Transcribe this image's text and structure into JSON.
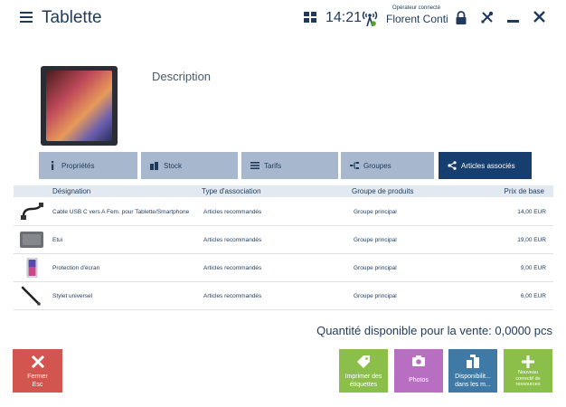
{
  "header": {
    "title": "Tablette",
    "time": "14:21",
    "operator_label": "Opérateur connecté",
    "operator_name": "Florent Conti"
  },
  "product": {
    "description": "Description"
  },
  "tabs": [
    {
      "label": "Propriétés",
      "icon": "info-icon",
      "active": false
    },
    {
      "label": "Stock",
      "icon": "warehouse-icon",
      "active": false
    },
    {
      "label": "Tarifs",
      "icon": "list-icon",
      "active": false
    },
    {
      "label": "Groupes",
      "icon": "tree-icon",
      "active": false
    },
    {
      "label": "Articles associés",
      "icon": "share-icon",
      "active": true
    }
  ],
  "table": {
    "headers": {
      "designation": "Désignation",
      "type": "Type d'association",
      "group": "Groupe de produits",
      "price": "Prix de base"
    },
    "rows": [
      {
        "name": "Cable USB C vers A Fem. pour Tablette/Smartphone",
        "type": "Articles recommandés",
        "group": "Groupe principal",
        "price": "14,00 EUR",
        "thumb": "cable-thumbnail"
      },
      {
        "name": "Etui",
        "type": "Articles recommandés",
        "group": "Groupe principal",
        "price": "19,00 EUR",
        "thumb": "case-thumbnail"
      },
      {
        "name": "Protection d'écran",
        "type": "Articles recommandés",
        "group": "Groupe principal",
        "price": "9,00 EUR",
        "thumb": "phone-thumbnail"
      },
      {
        "name": "Stylet universel",
        "type": "Articles recommandés",
        "group": "Groupe principal",
        "price": "6,00 EUR",
        "thumb": "stylus-thumbnail"
      }
    ]
  },
  "quantity": "Quantité disponible pour la vente: 0,0000 pcs",
  "buttons": {
    "close": {
      "line1": "Fermer",
      "line2": "Esc"
    },
    "print": {
      "line1": "Imprimer des",
      "line2": "étiquettes"
    },
    "photos": {
      "line1": "Photos"
    },
    "dispo": {
      "line1": "Disponibilit...",
      "line2": "dans les m..."
    },
    "new": {
      "line1": "Nouveau",
      "line2": "correctif de",
      "line3": "ressources"
    }
  },
  "colors": {
    "primary": "#163e6e",
    "tab_inactive": "#a7b7cd",
    "close": "#d2554f",
    "green": "#8bbf4a",
    "purple": "#b86fc1",
    "blue": "#3f7aa6"
  }
}
